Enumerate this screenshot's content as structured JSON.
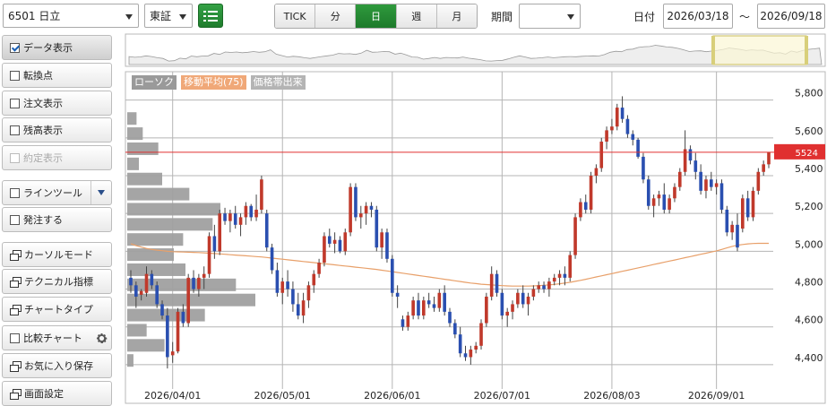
{
  "toolbar": {
    "symbol_value": "6501 日立",
    "market_value": "東証",
    "list_icon": "list-icon",
    "periods": [
      "TICK",
      "分",
      "日",
      "週",
      "月"
    ],
    "active_period": "日",
    "range_label": "期間",
    "range_value": "",
    "date_label": "日付",
    "date_from": "2026/03/18",
    "date_sep": "～",
    "date_to": "2026/09/18"
  },
  "sidebar": {
    "items": [
      {
        "label": "データ表示",
        "kind": "checkbox",
        "checked": true,
        "active": true
      },
      {
        "label": "転換点",
        "kind": "checkbox"
      },
      {
        "label": "注文表示",
        "kind": "checkbox"
      },
      {
        "label": "残高表示",
        "kind": "checkbox"
      },
      {
        "label": "約定表示",
        "kind": "checkbox",
        "disabled": true
      },
      {
        "label": "ラインツール",
        "kind": "checkbox",
        "extra": "dropdown"
      },
      {
        "label": "発注する",
        "kind": "checkbox"
      },
      {
        "label": "カーソルモード",
        "kind": "window"
      },
      {
        "label": "テクニカル指標",
        "kind": "window"
      },
      {
        "label": "チャートタイプ",
        "kind": "window"
      },
      {
        "label": "比較チャート",
        "kind": "checkbox",
        "extra": "gear"
      },
      {
        "label": "お気に入り保存",
        "kind": "window"
      },
      {
        "label": "画面設定",
        "kind": "window"
      }
    ]
  },
  "legend": {
    "candles": "ローソク",
    "ma": "移動平均(75)",
    "volume_profile": "価格帯出来"
  },
  "colors": {
    "up": "#c0392b",
    "down": "#2a4fb0",
    "ma": "#e8a06a",
    "profile": "#a0a0a0",
    "price_line": "#e03030",
    "active_green": "#2a8a36"
  },
  "chart_data": {
    "type": "candlestick",
    "ylim": [
      4300,
      5950
    ],
    "y_ticks": [
      5800,
      5600,
      5400,
      5200,
      5000,
      4800,
      4600,
      4400
    ],
    "y_tick_labels": [
      "5,800",
      "5,600",
      "5,400",
      "5,200",
      "5,000",
      "4,800",
      "4,600",
      "4,400"
    ],
    "x_tick_labels": [
      "2026/04/01",
      "2026/05/01",
      "2026/06/01",
      "2026/07/01",
      "2026/08/03",
      "2026/09/01"
    ],
    "x_tick_index": [
      8,
      29,
      50,
      71,
      92,
      112
    ],
    "last_price": 5524,
    "last_price_label": "5524",
    "candles": [
      [
        4860,
        4900,
        4780,
        4820
      ],
      [
        4820,
        4840,
        4700,
        4760
      ],
      [
        4770,
        4800,
        4740,
        4790
      ],
      [
        4780,
        4920,
        4760,
        4880
      ],
      [
        4880,
        4900,
        4800,
        4820
      ],
      [
        4820,
        4840,
        4700,
        4720
      ],
      [
        4720,
        4740,
        4640,
        4660
      ],
      [
        4660,
        4700,
        4380,
        4440
      ],
      [
        4450,
        4520,
        4410,
        4470
      ],
      [
        4470,
        4700,
        4460,
        4680
      ],
      [
        4680,
        4720,
        4600,
        4620
      ],
      [
        4620,
        4880,
        4600,
        4860
      ],
      [
        4860,
        4900,
        4780,
        4800
      ],
      [
        4800,
        4880,
        4760,
        4860
      ],
      [
        4860,
        4920,
        4800,
        4880
      ],
      [
        4880,
        5100,
        4860,
        5080
      ],
      [
        5080,
        5140,
        4960,
        5000
      ],
      [
        5000,
        5220,
        4980,
        5200
      ],
      [
        5200,
        5230,
        5140,
        5160
      ],
      [
        5160,
        5220,
        5100,
        5200
      ],
      [
        5200,
        5240,
        5120,
        5140
      ],
      [
        5140,
        5200,
        5080,
        5180
      ],
      [
        5180,
        5260,
        5140,
        5240
      ],
      [
        5240,
        5250,
        5160,
        5180
      ],
      [
        5180,
        5300,
        5160,
        5220
      ],
      [
        5220,
        5400,
        5200,
        5380
      ],
      [
        5200,
        5220,
        5000,
        5020
      ],
      [
        5020,
        5040,
        4880,
        4900
      ],
      [
        4900,
        4940,
        4760,
        4780
      ],
      [
        4780,
        4860,
        4720,
        4840
      ],
      [
        4840,
        4900,
        4760,
        4800
      ],
      [
        4800,
        4840,
        4680,
        4720
      ],
      [
        4720,
        4780,
        4640,
        4660
      ],
      [
        4660,
        4780,
        4620,
        4740
      ],
      [
        4740,
        4840,
        4700,
        4820
      ],
      [
        4820,
        4900,
        4780,
        4880
      ],
      [
        4880,
        4960,
        4860,
        4940
      ],
      [
        4940,
        5100,
        4920,
        5080
      ],
      [
        5080,
        5120,
        5020,
        5040
      ],
      [
        5040,
        5100,
        4990,
        5060
      ],
      [
        5060,
        5080,
        4990,
        5000
      ],
      [
        5000,
        5120,
        4980,
        5100
      ],
      [
        5100,
        5360,
        5080,
        5340
      ],
      [
        5340,
        5360,
        5160,
        5180
      ],
      [
        5180,
        5240,
        5120,
        5200
      ],
      [
        5200,
        5260,
        5140,
        5240
      ],
      [
        5240,
        5260,
        5180,
        5220
      ],
      [
        5220,
        5240,
        5000,
        5020
      ],
      [
        5020,
        5120,
        4960,
        5100
      ],
      [
        5100,
        5120,
        4940,
        4960
      ],
      [
        4960,
        4980,
        4760,
        4780
      ],
      [
        4780,
        4820,
        4700,
        4760
      ],
      [
        4640,
        4660,
        4580,
        4600
      ],
      [
        4600,
        4680,
        4580,
        4660
      ],
      [
        4660,
        4760,
        4640,
        4740
      ],
      [
        4740,
        4780,
        4640,
        4660
      ],
      [
        4660,
        4760,
        4640,
        4740
      ],
      [
        4740,
        4780,
        4700,
        4720
      ],
      [
        4720,
        4760,
        4680,
        4700
      ],
      [
        4700,
        4800,
        4680,
        4780
      ],
      [
        4780,
        4820,
        4660,
        4680
      ],
      [
        4680,
        4700,
        4600,
        4620
      ],
      [
        4620,
        4640,
        4540,
        4560
      ],
      [
        4560,
        4600,
        4440,
        4460
      ],
      [
        4460,
        4500,
        4420,
        4440
      ],
      [
        4440,
        4500,
        4400,
        4480
      ],
      [
        4480,
        4520,
        4460,
        4500
      ],
      [
        4500,
        4640,
        4480,
        4620
      ],
      [
        4620,
        4780,
        4600,
        4760
      ],
      [
        4760,
        4920,
        4740,
        4880
      ],
      [
        4880,
        4900,
        4760,
        4780
      ],
      [
        4780,
        4800,
        4640,
        4660
      ],
      [
        4660,
        4700,
        4600,
        4680
      ],
      [
        4680,
        4740,
        4640,
        4720
      ],
      [
        4720,
        4800,
        4700,
        4780
      ],
      [
        4780,
        4820,
        4700,
        4720
      ],
      [
        4720,
        4780,
        4660,
        4760
      ],
      [
        4760,
        4820,
        4740,
        4800
      ],
      [
        4800,
        4840,
        4780,
        4820
      ],
      [
        4820,
        4840,
        4780,
        4800
      ],
      [
        4800,
        4860,
        4760,
        4840
      ],
      [
        4840,
        4880,
        4820,
        4860
      ],
      [
        4860,
        4900,
        4820,
        4880
      ],
      [
        4880,
        4920,
        4820,
        4860
      ],
      [
        4860,
        5000,
        4840,
        4980
      ],
      [
        4980,
        5200,
        4960,
        5180
      ],
      [
        5180,
        5280,
        5160,
        5260
      ],
      [
        5260,
        5300,
        5200,
        5220
      ],
      [
        5220,
        5420,
        5200,
        5400
      ],
      [
        5400,
        5460,
        5360,
        5440
      ],
      [
        5440,
        5600,
        5420,
        5580
      ],
      [
        5580,
        5660,
        5540,
        5640
      ],
      [
        5640,
        5700,
        5620,
        5660
      ],
      [
        5660,
        5780,
        5640,
        5760
      ],
      [
        5760,
        5820,
        5680,
        5700
      ],
      [
        5700,
        5720,
        5600,
        5620
      ],
      [
        5620,
        5640,
        5560,
        5590
      ],
      [
        5590,
        5600,
        5490,
        5500
      ],
      [
        5500,
        5520,
        5360,
        5380
      ],
      [
        5380,
        5400,
        5220,
        5240
      ],
      [
        5240,
        5300,
        5180,
        5280
      ],
      [
        5280,
        5320,
        5240,
        5300
      ],
      [
        5300,
        5360,
        5200,
        5220
      ],
      [
        5220,
        5300,
        5200,
        5280
      ],
      [
        5280,
        5360,
        5260,
        5340
      ],
      [
        5340,
        5440,
        5320,
        5420
      ],
      [
        5420,
        5640,
        5400,
        5540
      ],
      [
        5540,
        5560,
        5460,
        5480
      ],
      [
        5480,
        5520,
        5380,
        5420
      ],
      [
        5420,
        5460,
        5300,
        5320
      ],
      [
        5320,
        5400,
        5280,
        5380
      ],
      [
        5380,
        5420,
        5320,
        5340
      ],
      [
        5340,
        5380,
        5300,
        5360
      ],
      [
        5360,
        5380,
        5200,
        5220
      ],
      [
        5220,
        5240,
        5080,
        5100
      ],
      [
        5100,
        5160,
        5060,
        5140
      ],
      [
        5140,
        5200,
        5000,
        5020
      ],
      [
        5120,
        5300,
        5100,
        5280
      ],
      [
        5280,
        5320,
        5160,
        5180
      ],
      [
        5180,
        5340,
        5160,
        5320
      ],
      [
        5320,
        5440,
        5300,
        5420
      ],
      [
        5420,
        5480,
        5400,
        5460
      ],
      [
        5460,
        5524,
        5440,
        5524
      ]
    ],
    "ma": [
      5040,
      5030,
      5022,
      5015,
      5010,
      5006,
      5003,
      5000,
      4998,
      4997,
      4996,
      4995,
      4994,
      4993,
      4992,
      4990,
      4988,
      4986,
      4984,
      4982,
      4980,
      4978,
      4976,
      4974,
      4972,
      4970,
      4967,
      4964,
      4961,
      4958,
      4955,
      4952,
      4949,
      4946,
      4943,
      4940,
      4937,
      4934,
      4931,
      4928,
      4925,
      4922,
      4919,
      4916,
      4913,
      4910,
      4907,
      4904,
      4900,
      4896,
      4892,
      4888,
      4884,
      4880,
      4876,
      4872,
      4868,
      4864,
      4860,
      4856,
      4852,
      4848,
      4844,
      4840,
      4836,
      4832,
      4829,
      4826,
      4824,
      4822,
      4820,
      4818,
      4817,
      4816,
      4816,
      4816,
      4816,
      4817,
      4818,
      4820,
      4822,
      4825,
      4828,
      4832,
      4836,
      4841,
      4846,
      4852,
      4858,
      4864,
      4870,
      4876,
      4882,
      4888,
      4894,
      4900,
      4906,
      4912,
      4918,
      4924,
      4930,
      4936,
      4942,
      4948,
      4954,
      4960,
      4966,
      4972,
      4978,
      4984,
      4990,
      4996,
      5002,
      5010,
      5018,
      5026,
      5032,
      5036,
      5039,
      5041,
      5042,
      5042,
      5042
    ],
    "volume_profile": [
      {
        "price": 5700,
        "volume": 12
      },
      {
        "price": 5620,
        "volume": 20
      },
      {
        "price": 5540,
        "volume": 40
      },
      {
        "price": 5460,
        "volume": 15
      },
      {
        "price": 5380,
        "volume": 45
      },
      {
        "price": 5300,
        "volume": 80
      },
      {
        "price": 5220,
        "volume": 120
      },
      {
        "price": 5140,
        "volume": 110
      },
      {
        "price": 5060,
        "volume": 72
      },
      {
        "price": 4980,
        "volume": 60
      },
      {
        "price": 4900,
        "volume": 75
      },
      {
        "price": 4820,
        "volume": 140
      },
      {
        "price": 4740,
        "volume": 165
      },
      {
        "price": 4660,
        "volume": 100
      },
      {
        "price": 4580,
        "volume": 25
      },
      {
        "price": 4500,
        "volume": 48
      },
      {
        "price": 4420,
        "volume": 8
      }
    ]
  }
}
